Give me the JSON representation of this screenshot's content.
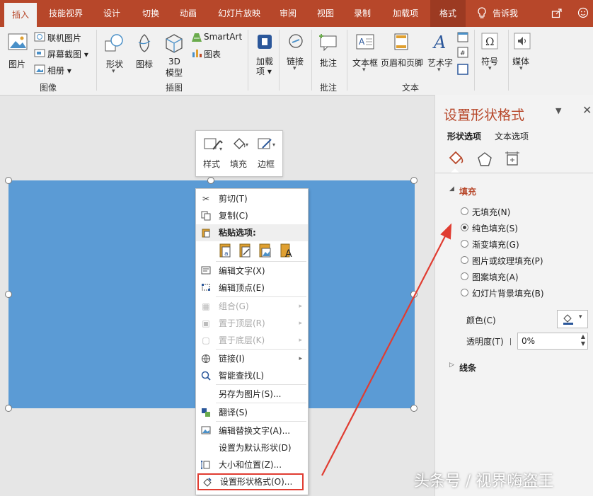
{
  "tabs": [
    "插入",
    "技能视界",
    "设计",
    "切换",
    "动画",
    "幻灯片放映",
    "审阅",
    "视图",
    "录制",
    "加载项",
    "格式"
  ],
  "tell_me": "告诉我",
  "ribbon": {
    "picture": "图片",
    "online_picture": "联机图片",
    "screenshot": "屏幕截图",
    "album": "相册",
    "group_image": "图像",
    "shapes": "形状",
    "icons": "图标",
    "model3d_line1": "3D",
    "model3d_line2": "模型",
    "smartart": "SmartArt",
    "chart": "图表",
    "group_illustration": "插图",
    "addin_line1": "加载",
    "addin_line2": "项",
    "link": "链接",
    "comment": "批注",
    "group_comment": "批注",
    "textbox": "文本框",
    "header_footer": "页眉和页脚",
    "wordart": "艺术字",
    "group_text": "文本",
    "symbol": "符号",
    "media": "媒体"
  },
  "mini_toolbar": {
    "style": "样式",
    "fill": "填充",
    "border": "边框"
  },
  "context_menu": {
    "cut": "剪切(T)",
    "copy": "复制(C)",
    "paste_options": "粘贴选项:",
    "edit_text": "编辑文字(X)",
    "edit_points": "编辑顶点(E)",
    "group": "组合(G)",
    "bring_front": "置于顶层(R)",
    "send_back": "置于底层(K)",
    "link": "链接(I)",
    "smart_lookup": "智能查找(L)",
    "save_as_picture": "另存为图片(S)...",
    "translate": "翻译(S)",
    "edit_alt_text": "编辑替换文字(A)...",
    "set_default": "设置为默认形状(D)",
    "size_position": "大小和位置(Z)...",
    "format_shape": "设置形状格式(O)..."
  },
  "pane": {
    "title": "设置形状格式",
    "tab_shape": "形状选项",
    "tab_text": "文本选项",
    "fill_section": "填充",
    "options": [
      "无填充(N)",
      "纯色填充(S)",
      "渐变填充(G)",
      "图片或纹理填充(P)",
      "图案填充(A)",
      "幻灯片背景填充(B)"
    ],
    "selected_index": 1,
    "color_label": "颜色(C)",
    "transparency_label": "透明度(T)",
    "transparency_value": "0%",
    "line_section": "线条"
  },
  "colors": {
    "accent": "#b7472a",
    "shape_fill": "#5b9bd5",
    "highlight": "#e03c31"
  },
  "watermark": "头条号 / 视界嗨盗王"
}
